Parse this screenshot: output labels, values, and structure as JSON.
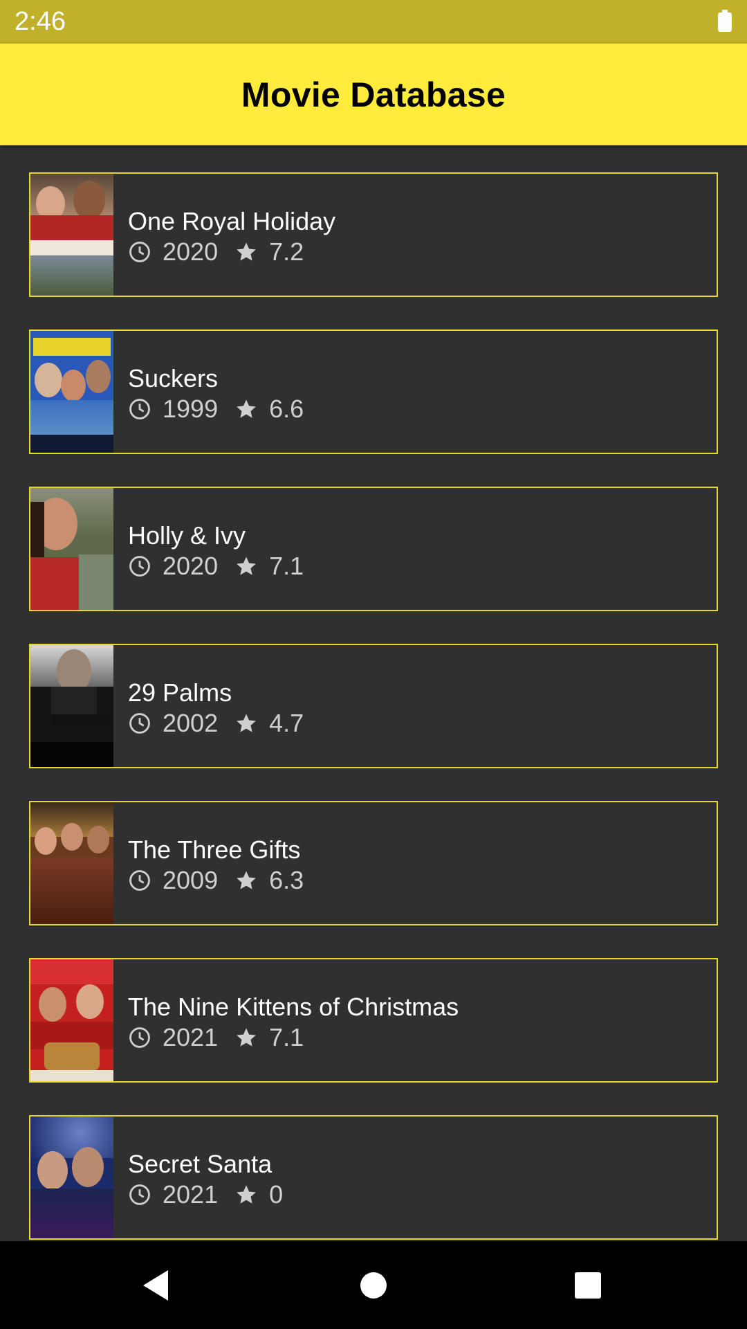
{
  "status_bar": {
    "time": "2:46",
    "battery_icon": "battery-full-icon"
  },
  "app_bar": {
    "title": "Movie Database",
    "color": "#ffeb3b"
  },
  "accent_border": "#e5d82a",
  "movies": [
    {
      "title": "One Royal Holiday",
      "year": "2020",
      "rating": "7.2"
    },
    {
      "title": "Suckers",
      "year": "1999",
      "rating": "6.6"
    },
    {
      "title": "Holly & Ivy",
      "year": "2020",
      "rating": "7.1"
    },
    {
      "title": "29 Palms",
      "year": "2002",
      "rating": "4.7"
    },
    {
      "title": "The Three Gifts",
      "year": "2009",
      "rating": "6.3"
    },
    {
      "title": "The Nine Kittens of Christmas",
      "year": "2021",
      "rating": "7.1"
    },
    {
      "title": "Secret Santa",
      "year": "2021",
      "rating": "0"
    }
  ],
  "nav_bar": {
    "back_icon": "back-triangle-icon",
    "home_icon": "home-circle-icon",
    "recents_icon": "recents-square-icon"
  }
}
